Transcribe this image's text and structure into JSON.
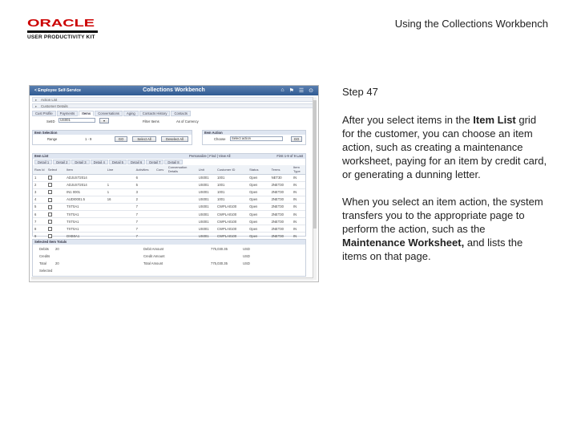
{
  "header": {
    "logo_brand": "ORACLE",
    "logo_sub": "USER PRODUCTIVITY KIT",
    "slide_title": "Using the Collections Workbench"
  },
  "content": {
    "step": "Step 47",
    "p1_a": "After you select items in the ",
    "p1_b": "Item List",
    "p1_c": " grid for the customer, you can choose an item action, such as creating a maintenance worksheet, paying for an item by credit card, or generating a dunning letter.",
    "p2_a": "When you select an item action, the system transfers you to the appropriate page to perform the action, such as the ",
    "p2_b": "Maintenance Worksheet,",
    "p2_c": " and lists the items on that page."
  },
  "shot": {
    "home_link": "< Employee Self-Service",
    "app_title": "Collections Workbench",
    "icons": [
      "home-icon",
      "flag-icon",
      "menu-icon",
      "more-icon"
    ],
    "panel1": "Action List",
    "panel2": "Customer Details",
    "tabs": [
      "Cust Profile",
      "Payments",
      "Items",
      "Conversations",
      "Aging",
      "Contacts History",
      "Contacts"
    ],
    "active_tab": "Items",
    "row1": {
      "setid_label": "SetID",
      "setid_value": "US001",
      "filter_label": "Filter Items",
      "as_of_label": "As of Currency"
    },
    "item_selection": "Item Selection",
    "item_action": "Item Action",
    "range_label": "Range",
    "range_value": "1 - 9",
    "btn_go": "GO",
    "btn_select_all": "Select All",
    "btn_deselect_all": "Deselect All",
    "action_label": "Choose",
    "action_value": "Select action",
    "grid": {
      "title": "Item List",
      "personalize": "Personalize | Find | View All",
      "pager": "First 1-9 of 9 Last",
      "tabs": [
        "Detail 1",
        "Detail 2",
        "Detail 3",
        "Detail 4",
        "Detail 5",
        "Detail 6",
        "Detail 7",
        "Detail 8"
      ],
      "headers": [
        "Row Id",
        "Select",
        "Item",
        "Line",
        "Activities",
        "Conv",
        "Conversation Details",
        "Unit",
        "Customer ID",
        "Status",
        "Terms",
        "Item Type"
      ],
      "rows": [
        [
          "1",
          "",
          "ADJUST2014",
          "",
          "6",
          "",
          "",
          "US001",
          "1001",
          "Open",
          "NET30",
          "IN"
        ],
        [
          "2",
          "",
          "ADJUST2014",
          "1",
          "5",
          "",
          "",
          "US001",
          "1001",
          "Open",
          "2NET30",
          "IN"
        ],
        [
          "3",
          "",
          "IN1 0001",
          "1",
          "3",
          "",
          "",
          "US001",
          "1001",
          "Open",
          "2NET30",
          "IN"
        ],
        [
          "4",
          "",
          "AUDI0001.5",
          "16",
          "2",
          "",
          "",
          "US001",
          "1001",
          "Open",
          "2NET30",
          "IN"
        ],
        [
          "5",
          "",
          "TXT0A1",
          "",
          "7",
          "",
          "",
          "US001",
          "CWPLA0100",
          "Open",
          "2NET30",
          "IN"
        ],
        [
          "6",
          "",
          "TXT0A1",
          "",
          "7",
          "",
          "",
          "US001",
          "CWPLA0100",
          "Open",
          "2NET30",
          "IN"
        ],
        [
          "7",
          "",
          "TXT0A1",
          "",
          "7",
          "",
          "",
          "US001",
          "CWPLA0100",
          "Open",
          "2NET30",
          "IN"
        ],
        [
          "8",
          "",
          "TXT0A1",
          "",
          "7",
          "",
          "",
          "US001",
          "CWPLA0100",
          "Open",
          "2NET30",
          "IN"
        ],
        [
          "9",
          "",
          "DXB0A1",
          "",
          "7",
          "",
          "",
          "US001",
          "CWPLA0100",
          "Open",
          "2NET30",
          "IN"
        ]
      ]
    },
    "totals": {
      "title": "Selected Item Totals",
      "rows": [
        {
          "label": "Debits",
          "count": "20",
          "amt_label": "Debit Amount",
          "amt": "775,030.35",
          "cur": "USD"
        },
        {
          "label": "Credits",
          "count": "",
          "amt_label": "Credit Amount",
          "amt": "",
          "cur": "USD"
        },
        {
          "label": "Total",
          "count": "20",
          "amt_label": "Total Amount",
          "amt": "775,030.35",
          "cur": "USD"
        },
        {
          "label": "Selected",
          "count": "",
          "amt_label": "",
          "amt": "",
          "cur": ""
        }
      ]
    }
  }
}
